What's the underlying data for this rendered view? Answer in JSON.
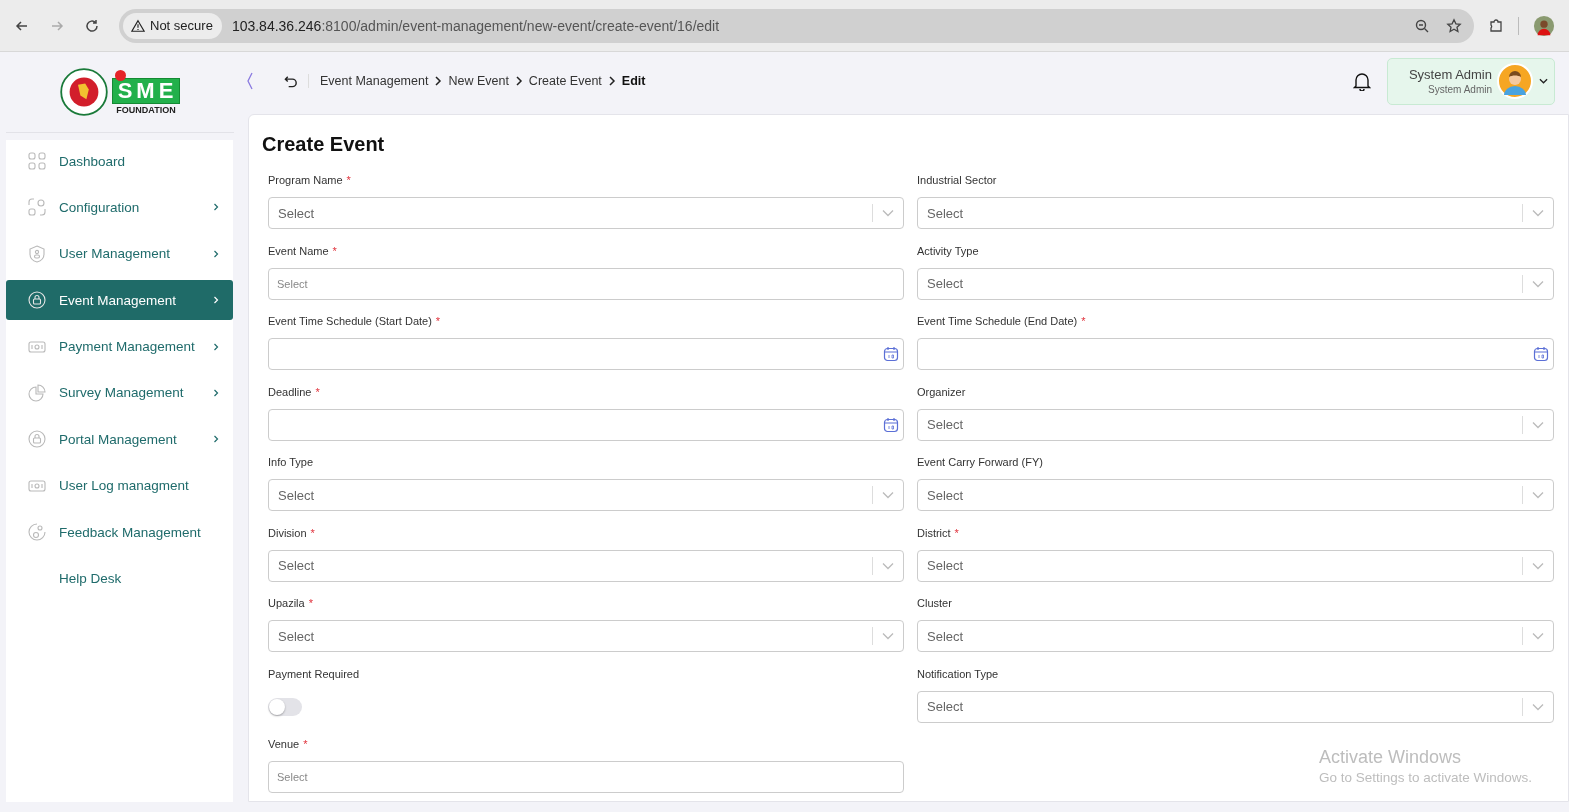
{
  "browser": {
    "security": "Not secure",
    "url_host": "103.84.36.246",
    "url_path": ":8100/admin/event-management/new-event/create-event/16/edit"
  },
  "logo": {
    "word": "SME",
    "caption": "FOUNDATION"
  },
  "sidebar": {
    "items": [
      {
        "label": "Dashboard",
        "selected": false,
        "expandable": false
      },
      {
        "label": "Configuration",
        "selected": false,
        "expandable": true
      },
      {
        "label": "User Management",
        "selected": false,
        "expandable": true
      },
      {
        "label": "Event Management",
        "selected": true,
        "expandable": true
      },
      {
        "label": "Payment Management",
        "selected": false,
        "expandable": true
      },
      {
        "label": "Survey Management",
        "selected": false,
        "expandable": true
      },
      {
        "label": "Portal Management",
        "selected": false,
        "expandable": true
      },
      {
        "label": "User Log managment",
        "selected": false,
        "expandable": false
      },
      {
        "label": "Feedback Management",
        "selected": false,
        "expandable": false
      },
      {
        "label": "Help Desk",
        "selected": false,
        "expandable": false
      }
    ]
  },
  "breadcrumb": [
    {
      "label": "Event Management",
      "current": false
    },
    {
      "label": "New Event",
      "current": false
    },
    {
      "label": "Create Event",
      "current": false
    },
    {
      "label": "Edit",
      "current": true
    }
  ],
  "user": {
    "name": "System Admin",
    "role": "System Admin"
  },
  "form": {
    "title": "Create Event",
    "fields": [
      {
        "label": "Program Name",
        "required": "*",
        "kind": "select",
        "placeholder": "Select"
      },
      {
        "label": "Industrial Sector",
        "kind": "select",
        "placeholder": "Select"
      },
      {
        "label": "Event Name",
        "required": "*",
        "kind": "text",
        "placeholder": "Select"
      },
      {
        "label": "Activity Type",
        "kind": "select",
        "placeholder": "Select"
      },
      {
        "label": "Event Time Schedule (Start Date)",
        "required": "*",
        "kind": "date"
      },
      {
        "label": "Event Time Schedule (End Date)",
        "required": "*",
        "kind": "date"
      },
      {
        "label": "Deadline",
        "required": "*",
        "kind": "date"
      },
      {
        "label": "Organizer",
        "kind": "select",
        "placeholder": "Select"
      },
      {
        "label": "Info Type",
        "kind": "select",
        "placeholder": "Select"
      },
      {
        "label": "Event Carry Forward (FY)",
        "kind": "select",
        "placeholder": "Select"
      },
      {
        "label": "Division",
        "required": "*",
        "kind": "select",
        "placeholder": "Select"
      },
      {
        "label": "District",
        "required": "*",
        "kind": "select",
        "placeholder": "Select"
      },
      {
        "label": "Upazila",
        "required": "*",
        "kind": "select",
        "placeholder": "Select"
      },
      {
        "label": "Cluster",
        "kind": "select",
        "placeholder": "Select"
      },
      {
        "label": "Payment Required",
        "kind": "toggle",
        "on": false
      },
      {
        "label": "Notification Type",
        "kind": "select",
        "placeholder": "Select"
      },
      {
        "label": "Venue",
        "required": "*",
        "kind": "text",
        "placeholder": "Select"
      }
    ]
  },
  "os_notice": {
    "title": "Activate Windows",
    "text": "Go to Settings to activate Windows."
  }
}
